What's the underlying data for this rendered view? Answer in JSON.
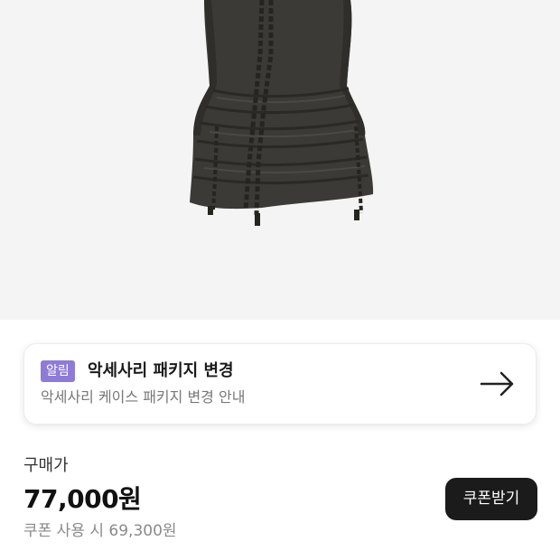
{
  "product": {
    "image_icon": "dark-ruched-halter-top-photo",
    "background_color": "#f4f4f4"
  },
  "notice": {
    "badge": "알림",
    "title": "악세사리 패키지 변경",
    "subtitle": "악세사리 케이스 패키지 변경 안내",
    "arrow_icon": "arrow-right-icon",
    "badge_color": "#8e7bd8"
  },
  "price": {
    "label": "구매가",
    "value": "77,000원",
    "coupon_price": "쿠폰 사용 시 69,300원",
    "coupon_button": "쿠폰받기"
  }
}
